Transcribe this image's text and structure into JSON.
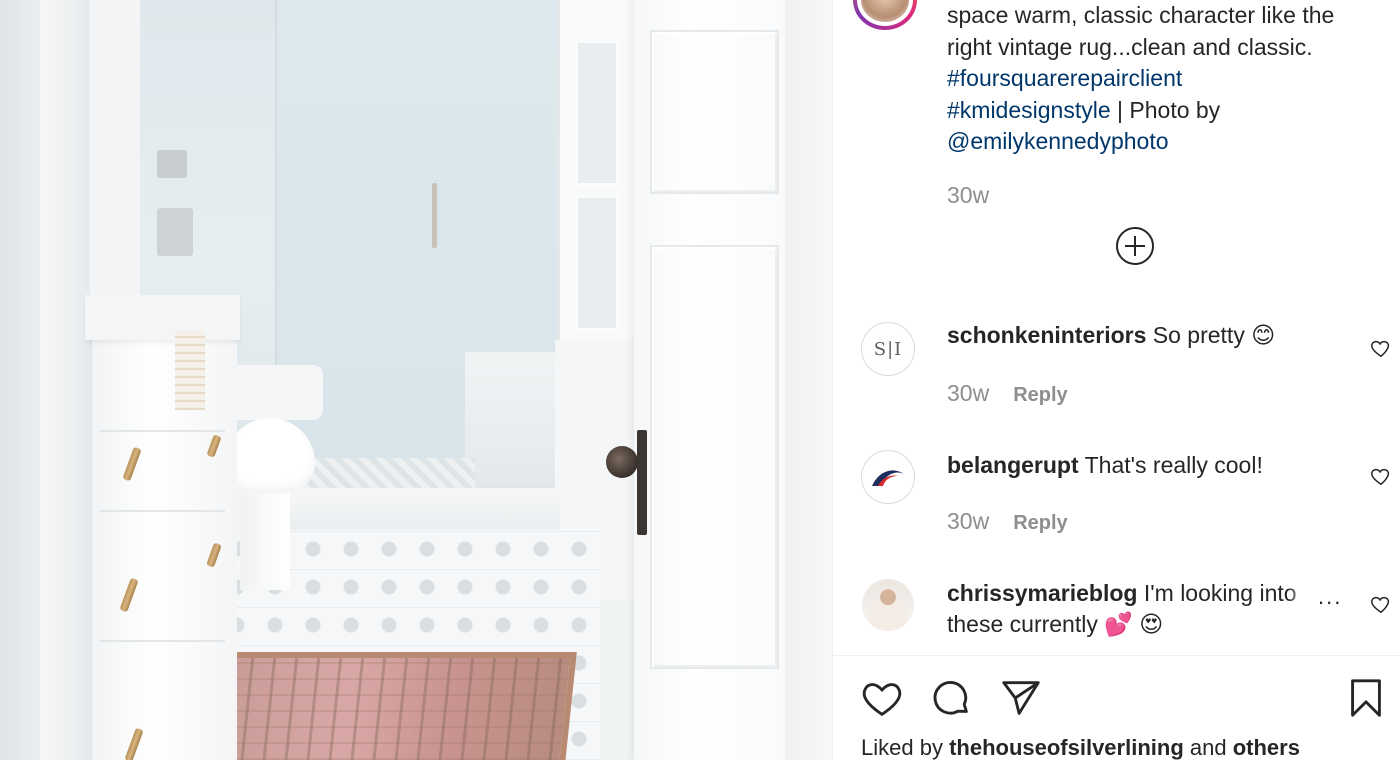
{
  "post": {
    "caption_lines": [
      "space warm, classic character like the",
      "right vintage rug...clean and classic."
    ],
    "hashtags": [
      "#foursquarerepairclient",
      "#kmidesignstyle"
    ],
    "photo_credit_text": " | Photo by",
    "photo_credit_handle": "@emilykennedyphoto",
    "time": "30w"
  },
  "comments": [
    {
      "username": "schonkeninteriors",
      "text": " So pretty 😊",
      "time": "30w",
      "reply_label": "Reply",
      "avatar_text": "S|I"
    },
    {
      "username": "belangerupt",
      "text": " That's really cool!",
      "time": "30w",
      "reply_label": "Reply"
    },
    {
      "username": "chrissymarieblog",
      "text": " I'm looking into",
      "text_line2": "these currently 💕 😍",
      "more": "..."
    }
  ],
  "footer": {
    "liked_prefix": "Liked by ",
    "liked_user": "thehouseofsilverlining",
    "liked_mid": " and ",
    "liked_suffix": "others"
  },
  "icons": {
    "like": "heart-icon",
    "comment": "comment-icon",
    "share": "paper-plane-icon",
    "save": "bookmark-icon",
    "load_more": "plus-circle-icon"
  },
  "colors": {
    "hashtag": "#00376b",
    "text": "#262626",
    "muted": "#8e8e8e",
    "divider": "#efefef"
  }
}
